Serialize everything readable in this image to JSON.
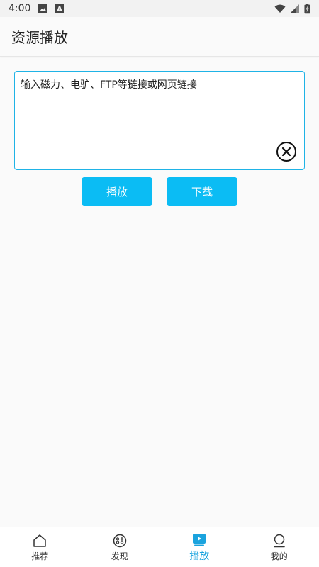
{
  "status": {
    "time": "4:00",
    "left_icons": [
      "image-icon",
      "a-letter-icon"
    ],
    "right_icons": [
      "wifi-icon",
      "signal-icon",
      "battery-charging-icon"
    ]
  },
  "appbar": {
    "title": "资源播放"
  },
  "input": {
    "value": "",
    "placeholder": "输入磁力、电驴、FTP等链接或网页链接",
    "clear_icon": "close-circle-icon"
  },
  "actions": {
    "play_label": "播放",
    "download_label": "下载"
  },
  "nav": {
    "items": [
      {
        "label": "推荐",
        "icon": "home-icon",
        "active": false
      },
      {
        "label": "发现",
        "icon": "film-reel-icon",
        "active": false
      },
      {
        "label": "播放",
        "icon": "play-icon",
        "active": true
      },
      {
        "label": "我的",
        "icon": "user-icon",
        "active": false
      }
    ]
  },
  "colors": {
    "accent": "#0bbcf4",
    "active_nav": "#1aa3de",
    "border_focus": "#1fb3e6"
  }
}
